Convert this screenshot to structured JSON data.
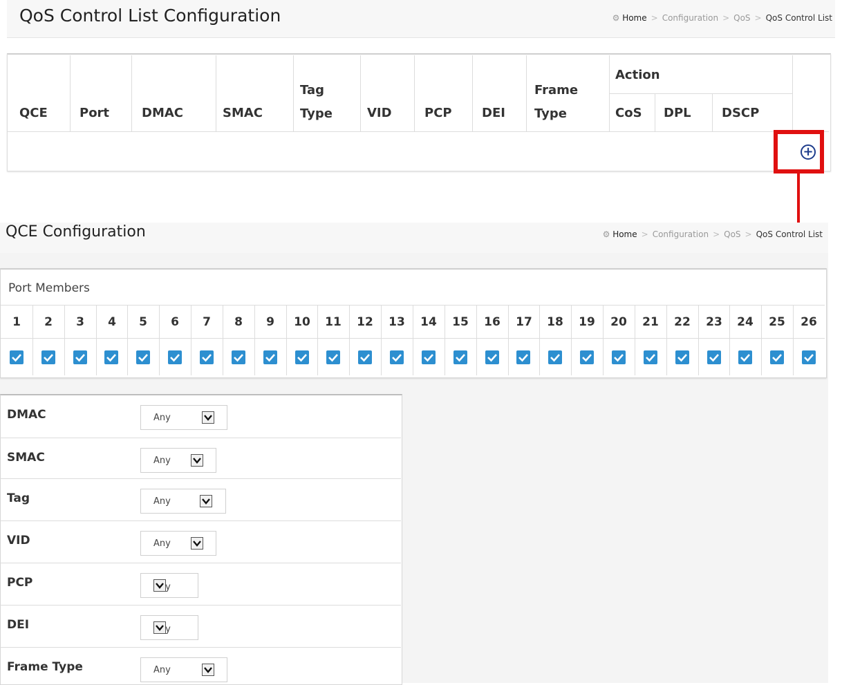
{
  "top": {
    "title": "QoS Control List Configuration",
    "breadcrumb": {
      "home": "Home",
      "items": [
        "Configuration",
        "QoS"
      ],
      "current": "QoS Control List"
    },
    "table": {
      "columns": [
        "QCE",
        "Port",
        "DMAC",
        "SMAC",
        "Tag Type",
        "VID",
        "PCP",
        "DEI",
        "Frame Type"
      ],
      "action_group": "Action",
      "action_columns": [
        "CoS",
        "DPL",
        "DSCP"
      ],
      "add_icon": "plus-circle-icon"
    }
  },
  "bottom": {
    "title": "QCE Configuration",
    "breadcrumb": {
      "home": "Home",
      "items": [
        "Configuration",
        "QoS"
      ],
      "current": "QoS Control List"
    },
    "port_members": {
      "label": "Port Members",
      "ports": [
        "1",
        "2",
        "3",
        "4",
        "5",
        "6",
        "7",
        "8",
        "9",
        "10",
        "11",
        "12",
        "13",
        "14",
        "15",
        "16",
        "17",
        "18",
        "19",
        "20",
        "21",
        "22",
        "23",
        "24",
        "25",
        "26"
      ],
      "checked": [
        true,
        true,
        true,
        true,
        true,
        true,
        true,
        true,
        true,
        true,
        true,
        true,
        true,
        true,
        true,
        true,
        true,
        true,
        true,
        true,
        true,
        true,
        true,
        true,
        true,
        true
      ]
    },
    "form": [
      {
        "label": "DMAC",
        "value": "Any"
      },
      {
        "label": "SMAC",
        "value": "Any"
      },
      {
        "label": "Tag",
        "value": "Any"
      },
      {
        "label": "VID",
        "value": "Any"
      },
      {
        "label": "PCP",
        "value": "Any"
      },
      {
        "label": "DEI",
        "value": "Any"
      },
      {
        "label": "Frame Type",
        "value": "Any"
      }
    ]
  },
  "colors": {
    "accent": "#2d8fd0",
    "highlight": "#e01010",
    "add_icon": "#1e3c8c"
  }
}
